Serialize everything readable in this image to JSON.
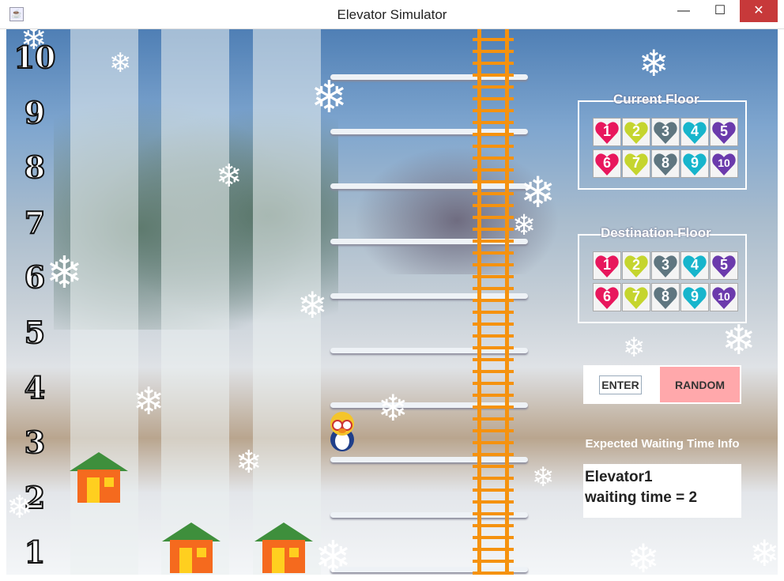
{
  "window": {
    "title": "Elevator Simulator",
    "minimize": "—",
    "maximize": "☐",
    "close": "✕"
  },
  "floors": [
    "10",
    "9",
    "8",
    "7",
    "6",
    "5",
    "4",
    "3",
    "2",
    "1"
  ],
  "current_floor": {
    "label": "Current Floor",
    "buttons": [
      "1",
      "2",
      "3",
      "4",
      "5",
      "6",
      "7",
      "8",
      "9",
      "10"
    ]
  },
  "destination_floor": {
    "label": "Destination Floor",
    "buttons": [
      "1",
      "2",
      "3",
      "4",
      "5",
      "6",
      "7",
      "8",
      "9",
      "10"
    ]
  },
  "colors": {
    "heart": [
      "#e8175d",
      "#c5d52e",
      "#5f7680",
      "#17b5cc",
      "#6b3aac"
    ],
    "random_button": "#ffa8ab",
    "ladder": "#f5920f"
  },
  "controls": {
    "enter": "ENTER",
    "random": "RANDOM"
  },
  "waiting": {
    "label": "Expected Waiting Time Info",
    "line1": "Elevator1",
    "line2": "waiting time = 2"
  },
  "elevators": [
    {
      "floor": 2
    },
    {
      "floor": 1
    },
    {
      "floor": 1
    }
  ],
  "passenger": {
    "floor": 3
  }
}
